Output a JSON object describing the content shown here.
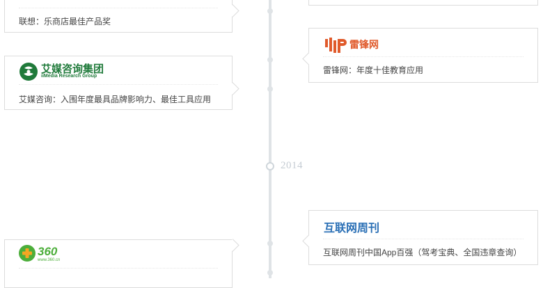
{
  "year": "2014",
  "cards": {
    "lenovo": {
      "desc": "联想：乐商店最佳产品奖"
    },
    "leifeng": {
      "logo_text": "雷锋网",
      "desc": "雷锋网：年度十佳教育应用"
    },
    "iimedia": {
      "logo_cn": "艾媒咨询集团",
      "logo_en": "iiMedia Research Group",
      "desc": "艾媒咨询：入围年度最具品牌影响力、最佳工具应用"
    },
    "hulian": {
      "logo_text": "互联网周刊",
      "desc": "互联网周刊中国App百强（驾考宝典、全国违章查询）"
    },
    "qihoo": {
      "logo_text": "360",
      "logo_sub": "www.360.cn"
    }
  },
  "colors": {
    "leifeng_orange": "#e05a2b",
    "hulian_blue": "#2a6fb5",
    "iimedia_green": "#1f7a3a",
    "qihoo_green": "#4cae3a",
    "qihoo_orange": "#f5a623",
    "line_gray": "#dfe3e6"
  }
}
